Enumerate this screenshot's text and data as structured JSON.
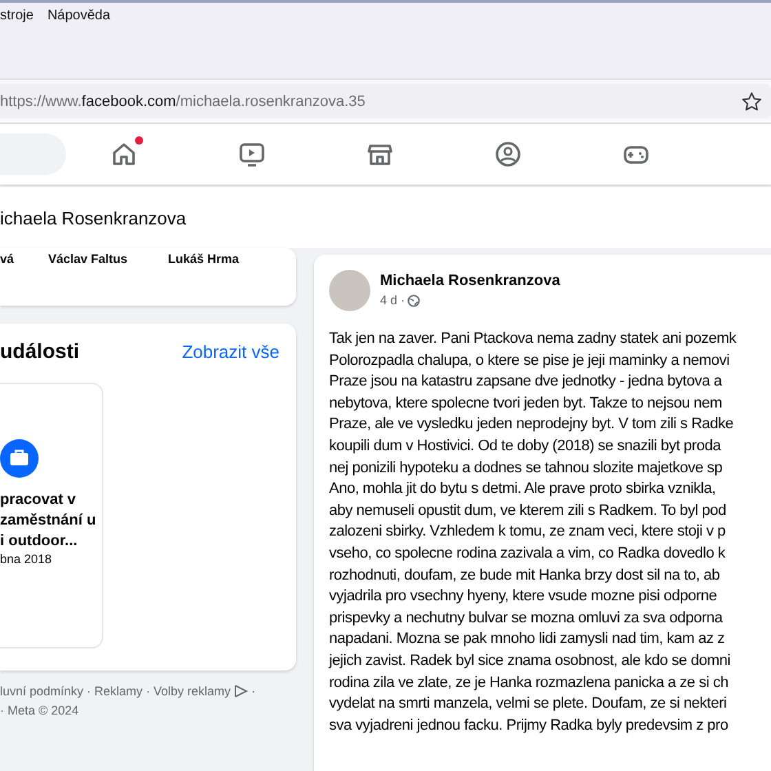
{
  "menu_bar": [
    "stroje",
    "Nápověda"
  ],
  "address_bar": {
    "url_plain": "https://www.",
    "url_domain": "facebook.com",
    "url_path": "/michaela.rosenkranzova.35",
    "bookmarked": false
  },
  "nav_icons": [
    {
      "kind": "home",
      "notification": true
    },
    {
      "kind": "video",
      "notification": false
    },
    {
      "kind": "marketplace",
      "notification": false
    },
    {
      "kind": "groups",
      "notification": false
    },
    {
      "kind": "gaming",
      "notification": false
    }
  ],
  "profile_header": {
    "name": "ichaela Rosenkranzova"
  },
  "friends": [
    "vá",
    "Václav Faltus",
    "Lukáš Hrma"
  ],
  "events": {
    "title": "události",
    "see_all": "Zobrazit vše",
    "card": {
      "title_lines": [
        "pracovat v",
        "zaměstnání u",
        "i outdoor..."
      ],
      "date": "bna 2018"
    }
  },
  "footer": {
    "line_1": "luvní podmínky · Reklamy · Volby reklamy",
    "line_1_end": "·",
    "line_2": "· Meta © 2024"
  },
  "post": {
    "author": "Michaela Rosenkranzova",
    "time": "4 d ·",
    "lines": [
      "Tak jen na zaver. Pani Ptackova nema zadny statek ani pozemk",
      "Polorozpadla chalupa, o ktere se pise je jeji maminky a nemovi",
      "Praze jsou na katastru zapsane dve jednotky - jedna bytova a",
      "nebytova, ktere spolecne tvori jeden byt. Takze to nejsou nem",
      "Praze, ale ve vysledku jeden neprodejny byt. V tom zili s Radke",
      "koupili dum v Hostivici. Od te doby (2018) se snazili byt proda",
      "nej ponizili hypoteku a dodnes se tahnou slozite majetkove sp",
      "Ano, mohla jit do bytu s detmi. Ale prave proto sbirka vznikla,",
      "aby nemuseli opustit dum, ve kterem zili s Radkem. To byl pod",
      "zalozeni sbirky. Vzhledem k tomu, ze znam veci, ktere stoji v p",
      "vseho, co spolecne rodina zazivala a vim, co Radka dovedlo k",
      "rozhodnuti, doufam, ze bude mit Hanka brzy dost sil na to, ab",
      "vyjadrila pro vsechny hyeny, ktere vsude mozne pisi odporne",
      "prispevky a nechutny bulvar se mozna omluvi za sva odporna",
      "napadani. Mozna se pak mnoho lidi zamysli nad tim, kam az z",
      "jejich zavist. Radek byl sice znama osobnost, ale kdo se domni",
      "rodina zila ve zlate, ze je Hanka rozmazlena panicka a ze si ch",
      "vydelat na smrti manzela, velmi se plete. Doufam, ze si nekteri",
      "sva vyjadreni jednou facku. Prijmy Radka byly predevsim z pro"
    ]
  }
}
